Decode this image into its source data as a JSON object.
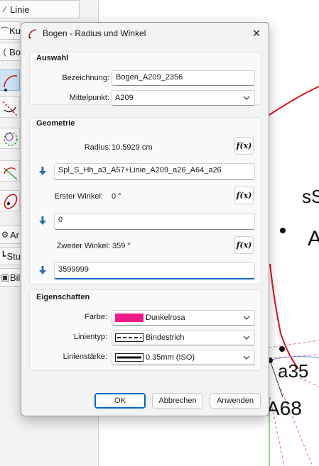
{
  "background": {
    "toolbar_buttons": [
      {
        "label": "Linie"
      },
      {
        "label": "Ku"
      },
      {
        "label": "Bo"
      },
      {
        "label": "Ar"
      },
      {
        "label": "Stu"
      },
      {
        "label": "Bil"
      }
    ],
    "canvas_labels": {
      "s_label": "sS",
      "a_label": "A",
      "a35_label": "a35",
      "a68_label": "A68"
    }
  },
  "dialog": {
    "title": "Bogen - Radius und Winkel",
    "auswahl": {
      "title": "Auswahl",
      "bezeichnung_label": "Bezeichnung:",
      "bezeichnung_value": "Bogen_A209_2356",
      "mittelpunkt_label": "Mittelpunkt:",
      "mittelpunkt_value": "A209"
    },
    "geometrie": {
      "title": "Geometrie",
      "radius_label": "Radius:",
      "radius_value": "10.5929 cm",
      "radius_expression": "Spl_S_Hh_a3_A57+Linie_A209_a26_A64_a26",
      "erster_winkel_label": "Erster Winkel:",
      "erster_winkel_value": "0 °",
      "erster_winkel_expression": "0",
      "zweiter_winkel_label": "Zweiter Winkel:",
      "zweiter_winkel_value": "359 °",
      "zweiter_winkel_expression": "3599999",
      "fx_label": "f(x)"
    },
    "eigenschaften": {
      "title": "Eigenschaften",
      "farbe_label": "Farbe:",
      "farbe_value": "Dunkelrosa",
      "farbe_color": "#ec1c8c",
      "linientyp_label": "Linientyp:",
      "linientyp_value": "Bindestrich",
      "linienstaerke_label": "Linienstärke:",
      "linienstaerke_value": "0.35mm (ISO)"
    },
    "buttons": {
      "ok": "OK",
      "abbrechen": "Abbrechen",
      "anwenden": "Anwenden"
    }
  }
}
